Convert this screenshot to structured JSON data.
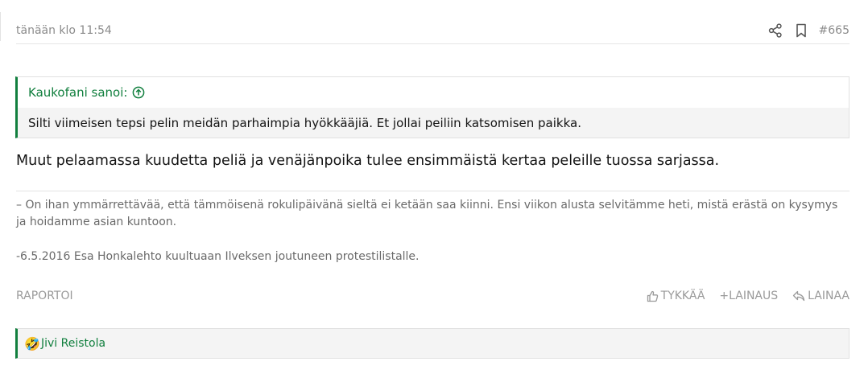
{
  "post": {
    "time": "tänään klo 11:54",
    "number": "#665",
    "icons": {
      "share": "share-icon",
      "bookmark": "bookmark-icon"
    }
  },
  "quote": {
    "author": "Kaukofani sanoi:",
    "icon": "arrow-up-circle-icon",
    "text": "Silti viimeisen tepsi pelin meidän parhaimpia hyökkääjiä. Et jollai peiliin katsomisen paikka."
  },
  "message": "Muut pelaamassa kuudetta peliä ja venäjänpoika tulee ensimmäistä kertaa peleille tuossa sarjassa.",
  "signature": {
    "line1": "– On ihan ymmärrettävää, että tämmöisenä rokulipäivänä sieltä ei ketään saa kiinni. Ensi viikon alusta selvitämme heti, mistä erästä on kysymys ja hoidamme asian kuntoon.",
    "line2": "-6.5.2016 Esa Honkalehto kuultuaan Ilveksen joutuneen protestilistalle."
  },
  "footer": {
    "report": "RAPORTOI",
    "like": "TYKKÄÄ",
    "multiquote": "+LAINAUS",
    "reply": "LAINAA",
    "icons": {
      "like": "thumbs-up-icon",
      "reply": "reply-icon"
    }
  },
  "reactions": {
    "emoji": "🤣",
    "icon": "rolling-laugh-emoji-icon",
    "users": "Jivi Reistola"
  },
  "colors": {
    "accent": "#117f3e",
    "muted": "#8b8b8b",
    "quote_bg": "#f4f4f4"
  }
}
